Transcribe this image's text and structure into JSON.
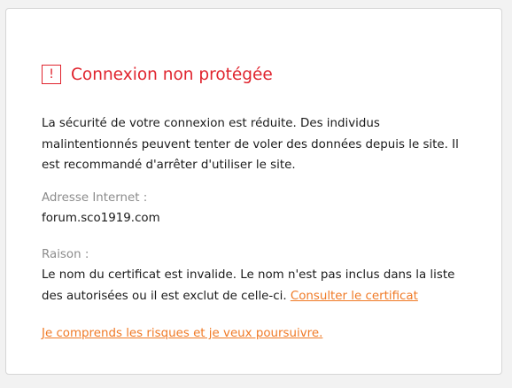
{
  "warning": {
    "icon_glyph": "!",
    "icon_name": "warning-icon",
    "title": "Connexion non protégée",
    "description": "La sécurité de votre connexion est réduite. Des individus malintentionnés peuvent tenter de voler des données depuis le site. Il est recommandé d'arrêter d'utiliser le site.",
    "address_label": "Adresse Internet :",
    "address_value": "forum.sco1919.com",
    "reason_label": "Raison :",
    "reason_text": "Le nom du certificat est invalide. Le nom n'est pas inclus dans la liste des autorisées ou il est exclut de celle-ci. ",
    "view_certificate_link": "Consulter le certificat",
    "proceed_link": "Je comprends les risques et je veux poursuivre.",
    "colors": {
      "accent_red": "#e0242e",
      "link_orange": "#f07a26",
      "label_gray": "#8c8c8c"
    }
  }
}
